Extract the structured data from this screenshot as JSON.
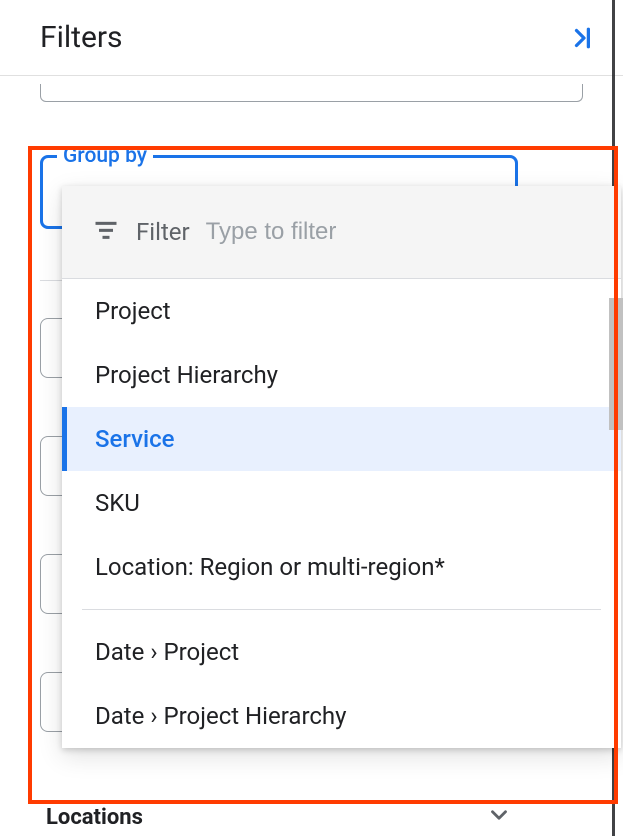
{
  "header": {
    "title": "Filters"
  },
  "groupby": {
    "legend": "Group by"
  },
  "dropdown": {
    "filter_label": "Filter",
    "filter_placeholder": "Type to filter",
    "group_a": [
      {
        "label": "Project",
        "selected": false
      },
      {
        "label": "Project Hierarchy",
        "selected": false
      },
      {
        "label": "Service",
        "selected": true
      },
      {
        "label": "SKU",
        "selected": false
      },
      {
        "label": "Location: Region or multi-region*",
        "selected": false
      }
    ],
    "group_b": [
      {
        "label": "Date › Project"
      },
      {
        "label": "Date › Project Hierarchy"
      }
    ]
  },
  "sections": {
    "locations": "Locations"
  }
}
